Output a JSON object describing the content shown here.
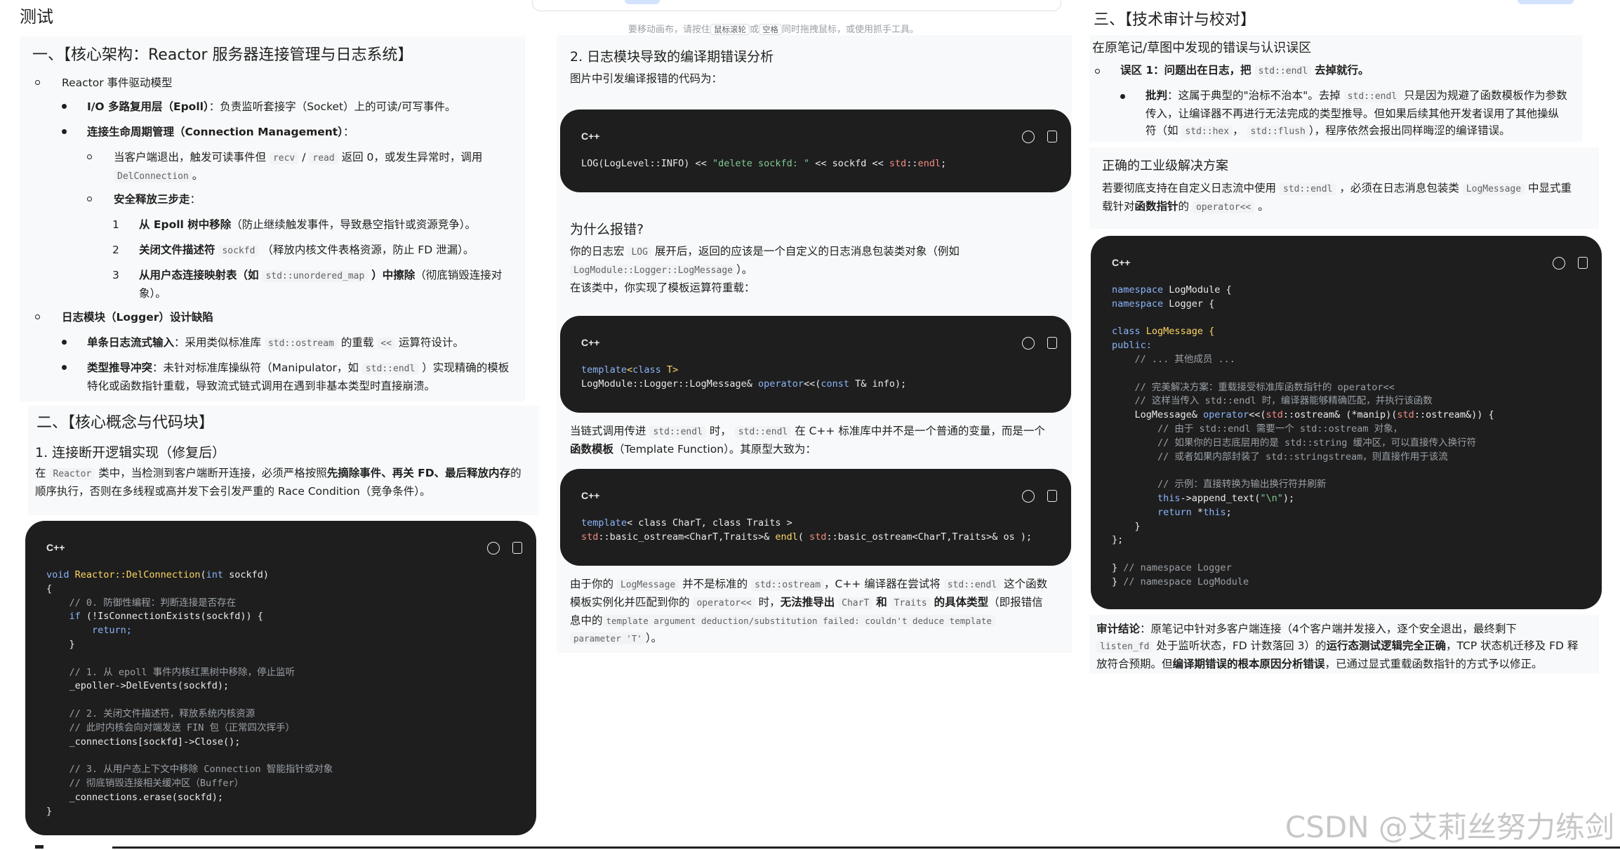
{
  "page": {
    "title": "测试",
    "hint": "要移动画布，请按住 鼠标滚轮 或 空格 同时拖拽鼠标，或使用抓手工具。",
    "hint_parts": [
      "要移动画布，请按住",
      "鼠标滚轮",
      "或",
      "空格",
      "同时拖拽鼠标，或使用抓手工具。"
    ]
  },
  "left": {
    "h1": "一、【核心架构：Reactor 服务器连接管理与日志系统】",
    "items": {
      "reactor": "Reactor 事件驱动模型",
      "io_a": "I/O 多路复用层（Epoll）",
      "io_b": "：负责监听套接字（Socket）上的可读/可写事件。",
      "lc": "连接生命周期管理（Connection Management）",
      "lc_b": "：",
      "disc_a": "当客户端退出，触发可读事件但",
      "disc_recv": "recv",
      "disc_slash": "/",
      "disc_read": "read",
      "disc_b": "返回 0，或发生异常时，调用",
      "disc_fn": "DelConnection",
      "disc_c": "。",
      "safe": "安全释放三步走",
      "safe_b": "：",
      "s1n": "1",
      "s1a": "从 Epoll 树中移除",
      "s1b": "（防止继续触发事件，导致悬空指针或资源竞争）。",
      "s2n": "2",
      "s2a": "关闭文件描述符",
      "s2code": "sockfd",
      "s2b": "（释放内核文件表格资源，防止 FD 泄漏）。",
      "s3n": "3",
      "s3a": "从用户态连接映射表（如",
      "s3code": "std::unordered_map",
      "s3b": "）中擦除",
      "s3c": "（彻底销毁连接对",
      "s3d": "象）。",
      "log": "日志模块（Logger）设计缺陷",
      "log1a": "单条日志流式输入",
      "log1b": "：采用类似标准库",
      "log1code": "std::ostream",
      "log1c": "的重载",
      "log1code2": "<<",
      "log1d": "运算符设计。",
      "log2a": "类型推导冲突",
      "log2b": "：未针对标准库操纵符（Manipulator，如",
      "log2code": "std::endl",
      "log2c": "）实现精确的模板",
      "log2d": "特化或函数指针重载，导致流式链式调用在遇到非基本类型时直接崩溃。"
    },
    "h2": "二、【核心概念与代码块】",
    "h3": "1. 连接断开逻辑实现（修复后）",
    "p_a": "在",
    "p_code": "Reactor",
    "p_b": "类中，当检测到客户端断开连接，必须严格按照",
    "p_bold": "先摘除事件、再关 FD、最后释放内存",
    "p_c": "的",
    "p_d": "顺序执行，否则在多线程或高并发下会引发严重的 Race Condition（竞争条件）。",
    "code": {
      "lang": "C++",
      "l1a": "void",
      "l1b": "Reactor::DelConnection",
      "l1c": "(",
      "l1d": "int",
      "l1e": " sockfd)",
      "l2": "{",
      "l3": "    // 0. 防御性编程：判断连接是否存在",
      "l4a": "    if",
      "l4b": " (!IsConnectionExists(sockfd)) {",
      "l5": "        return;",
      "l6": "    }",
      "l8": "    // 1. 从 epoll 事件内核红黑树中移除，停止监听",
      "l9": "    _epoller->DelEvents(sockfd);",
      "l11": "    // 2. 关闭文件描述符，释放系统内核资源",
      "l12": "    // 此时内核会向对端发送 FIN 包（正常四次挥手）",
      "l13": "    _connections[sockfd]->Close();",
      "l15": "    // 3. 从用户态上下文中移除 Connection 智能指针或对象",
      "l16": "    // 彻底销毁连接相关缓冲区（Buffer）",
      "l17": "    _connections.erase(sockfd);",
      "l18": "}"
    }
  },
  "middle": {
    "h3": "2. 日志模块导致的编译期错误分析",
    "p1": "图片中引发编译报错的代码为：",
    "code1": {
      "lang": "C++",
      "a": "LOG(LogLevel::INFO) << ",
      "s": "\"delete sockfd: \"",
      "b": " << sockfd << ",
      "n": "std",
      "c": "::",
      "e": "endl",
      "d": ";"
    },
    "h4": "为什么报错?",
    "p2a": "你的日志宏",
    "p2code": "LOG",
    "p2b": "展开后，返回的应该是一个自定义的日志消息包装类对象（例如",
    "p2code2": "LogModule::Logger::LogMessage",
    "p2c": "）。",
    "p2d": "在该类中，你实现了模板运算符重载：",
    "code2": {
      "lang": "C++",
      "t1": "template",
      "t2": "<",
      "t3": "class",
      "t4": " T>",
      "l2a": "LogModule::Logger::LogMessage& ",
      "l2b": "operator",
      "l2c": "<<(",
      "l2d": "const",
      "l2e": " T& info);"
    },
    "p3a": "当链式调用传进",
    "p3code": "std::endl",
    "p3b": "时，",
    "p3code2": "std::endl",
    "p3c": "在 C++ 标准库中并不是一个普通的变量，而是一个",
    "p3bold": "函数模板",
    "p3d": "（Template Function）。其原型大致为：",
    "code3": {
      "lang": "C++",
      "l1a": "template",
      "l1b": "< class CharT, class Traits >",
      "l2a": "std",
      "l2b": "::basic_ostream<CharT,Traits>& ",
      "l2c": "endl",
      "l2d": "( ",
      "l2e": "std",
      "l2f": "::basic_ostream<CharT,Traits>& os );"
    },
    "p4a": "由于你的",
    "p4code": "LogMessage",
    "p4b": "并不是标准的",
    "p4code2": "std::ostream",
    "p4c": "，C++ 编译器在尝试将",
    "p4code3": "std::endl",
    "p4d": "这个函数",
    "p4e": "模板实例化并匹配到你的",
    "p4code4": "operator<<",
    "p4f": "时，",
    "p4bold": "无法推导出",
    "p4code5": "CharT",
    "p4bold2": "和",
    "p4code6": "Traits",
    "p4bold3": "的具体类型",
    "p4g": "（即报错信",
    "p4h": "息中的",
    "p4code7": "template argument deduction/substitution failed: couldn't deduce template",
    "p4code8": "parameter 'T'",
    "p4i": "）。"
  },
  "right": {
    "h2": "三、【技术审计与校对】",
    "sub": "在原笔记/草图中发现的错误与认识误区",
    "e1a": "误区 1：问题出在日志，把",
    "e1code": "std::endl",
    "e1b": "去掉就行。",
    "e2a": "批判",
    "e2b": "：这属于典型的\"治标不治本\"。去掉",
    "e2code": "std::endl",
    "e2c": "只是因为规避了函数模板作为参数",
    "e2d": "传入，让编译器不再进行无法完成的类型推导。但如果后续其他开发者误用了其他操纵",
    "e2e": "符（如",
    "e2code2": "std::hex",
    "e2f": "，",
    "e2code3": "std::flush",
    "e2g": "），程序依然会报出同样晦涩的编译错误。",
    "h3": "正确的工业级解决方案",
    "p1a": "若要彻底支持在自定义日志流中使用",
    "p1code": "std::endl",
    "p1b": "，必须在日志消息包装类",
    "p1code2": "LogMessage",
    "p1c": "中显式重",
    "p1d": "载针对",
    "p1bold": "函数指针",
    "p1e": "的",
    "p1code3": "operator<<",
    "p1f": "。",
    "code": {
      "lang": "C++",
      "l1a": "namespace",
      "l1b": " LogModule {",
      "l2a": "namespace",
      "l2b": " Logger {",
      "l4a": "class",
      "l4b": " LogMessage {",
      "l5": "public:",
      "l6": "    // ... 其他成员 ...",
      "l8": "    // 完美解决方案：重载接受标准库函数指针的 operator<<",
      "l9": "    // 这样当传入 std::endl 时，编译器能够精确匹配，并执行该函数",
      "l10a": "    LogMessage& ",
      "l10b": "operator",
      "l10c": "<<(",
      "l10d": "std",
      "l10e": "::ostream& (*manip)(",
      "l10f": "std",
      "l10g": "::ostream&)) {",
      "l11": "        // 由于 std::endl 需要一个 std::ostream 对象，",
      "l12": "        // 如果你的日志底层用的是 std::string 缓冲区，可以直接传入换行符",
      "l13": "        // 或者如果内部封装了 std::stringstream，则直接作用于该流",
      "l15": "        // 示例：直接转换为输出换行符并刷新",
      "l16a": "        this",
      "l16b": "->append_text(",
      "l16c": "\"\\n\"",
      "l16d": ");",
      "l17a": "        return",
      "l17b": " *",
      "l17c": "this",
      "l17d": ";",
      "l18": "    }",
      "l19": "};",
      "l21a": "} ",
      "l21b": "// namespace Logger",
      "l22a": "} ",
      "l22b": "// namespace LogModule"
    },
    "concl_bold": "审计结论",
    "concl_a": "：原笔记中针对多客户端连接（4个客户端并发接入，逐个安全退出，最终剩下",
    "concl_code": "listen_fd",
    "concl_b": "处于监听状态，FD 计数落回 3）的",
    "concl_bold2": "运行态测试逻辑完全正确",
    "concl_c": "，TCP 状态机迁移及 FD 释",
    "concl_d": "放符合预期。但",
    "concl_bold3": "编译期错误的根本原因分析错误",
    "concl_e": "，已通过显式重载函数指针的方式予以修正。"
  },
  "watermark": "CSDN @艾莉丝努力练剑",
  "colors": {
    "code_bg": "#1e1e1e",
    "panel_bg": "#f8f9fa",
    "keyword": "#8ab4f8",
    "function": "#fdd663",
    "comment": "#9aa0a6",
    "string": "#81c995"
  }
}
